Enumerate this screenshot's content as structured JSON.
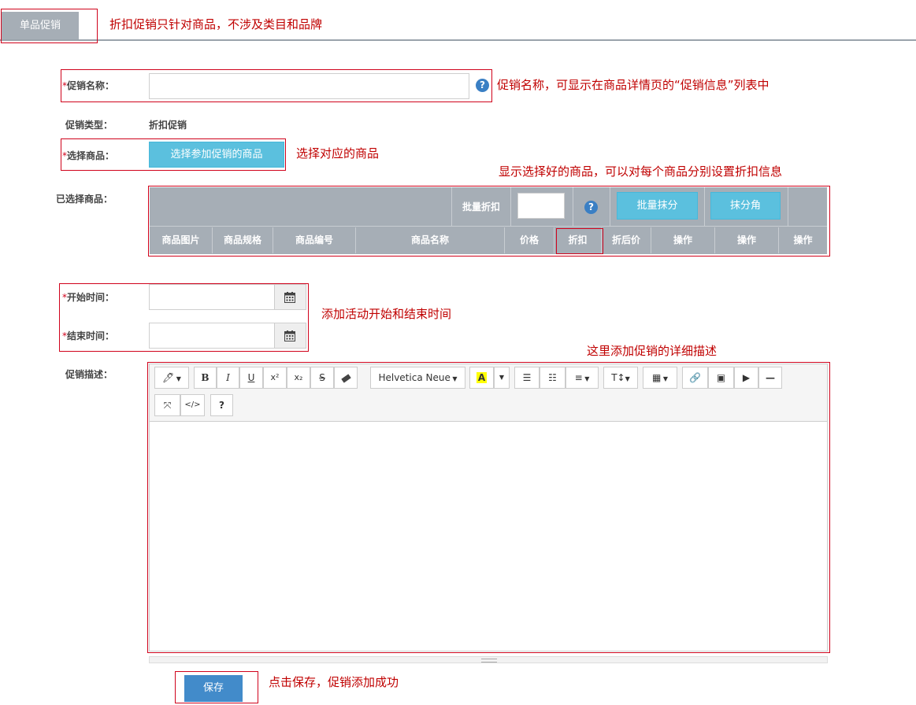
{
  "tab": {
    "label": "单品促销"
  },
  "notes": {
    "tab_note": "折扣促销只针对商品，不涉及类目和品牌",
    "name_note": "促销名称，可显示在商品详情页的“促销信息”列表中",
    "select_note": "选择对应的商品",
    "table_note": "显示选择好的商品，可以对每个商品分别设置折扣信息",
    "time_note": "添加活动开始和结束时间",
    "desc_note": "这里添加促销的详细描述",
    "save_note": "点击保存，促销添加成功"
  },
  "form": {
    "required_mark": "*",
    "name_label": "促销名称：",
    "name_value": "",
    "type_label": "促销类型：",
    "type_value": "折扣促销",
    "select_label": "选择商品：",
    "select_button": "选择参加促销的商品",
    "selected_label": "已选择商品：",
    "start_label": "开始时间：",
    "start_value": "",
    "end_label": "结束时间：",
    "end_value": "",
    "desc_label": "促销描述：",
    "save_button": "保存"
  },
  "table": {
    "batch_discount_label": "批量折扣",
    "batch_discount_value": "",
    "batch_round_button": "批量抹分",
    "round_jiao_button": "抹分角",
    "columns": [
      "商品图片",
      "商品规格",
      "商品编号",
      "商品名称",
      "价格",
      "折扣",
      "折后价",
      "操作",
      "操作",
      "操作"
    ]
  },
  "editor": {
    "font_name": "Helvetica Neue",
    "help": "?"
  },
  "colors": {
    "annotation_red": "#c00000",
    "accent_blue": "#5bc0de",
    "header_gray": "#a6aeb6",
    "save_blue": "#428bca"
  }
}
